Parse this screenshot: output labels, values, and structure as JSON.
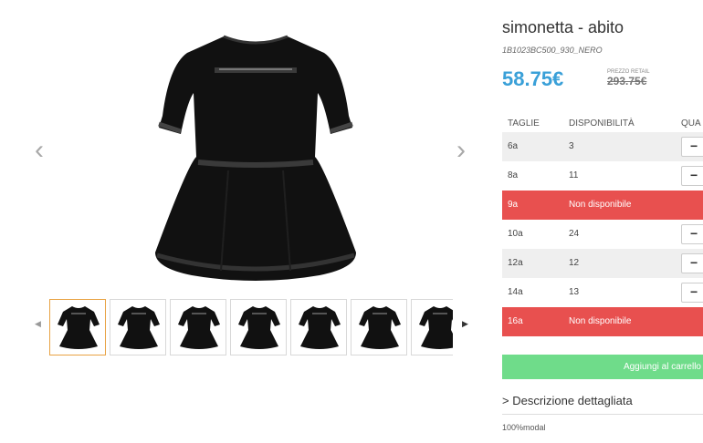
{
  "product": {
    "title": "simonetta - abito",
    "sku": "1B1023BC500_930_NERO",
    "price": "58.75€",
    "retail_label": "PREZZO RETAIL",
    "retail_price": "293.75€"
  },
  "gallery": {
    "prev_icon": "chevron-left-icon",
    "next_icon": "chevron-right-icon",
    "thumb_count": 7,
    "active_thumb": 0
  },
  "table": {
    "headers": [
      "TAGLIE",
      "DISPONIBILITÀ",
      "QUA"
    ],
    "rows": [
      {
        "size": "6a",
        "availability": "3",
        "status": "available"
      },
      {
        "size": "8a",
        "availability": "11",
        "status": "available"
      },
      {
        "size": "9a",
        "availability": "Non disponibile",
        "status": "unavailable"
      },
      {
        "size": "10a",
        "availability": "24",
        "status": "available"
      },
      {
        "size": "12a",
        "availability": "12",
        "status": "available"
      },
      {
        "size": "14a",
        "availability": "13",
        "status": "available"
      },
      {
        "size": "16a",
        "availability": "Non disponibile",
        "status": "unavailable"
      }
    ],
    "minus_label": "−"
  },
  "cart": {
    "label": "Aggiungi al carrello"
  },
  "description": {
    "toggle_label": "> Descrizione dettagliata",
    "material": "100%modal"
  },
  "colors": {
    "price": "#3aa0d8",
    "unavailable": "#e8504f",
    "cart": "#6fdc8a",
    "active_thumb_border": "#e8a243"
  }
}
